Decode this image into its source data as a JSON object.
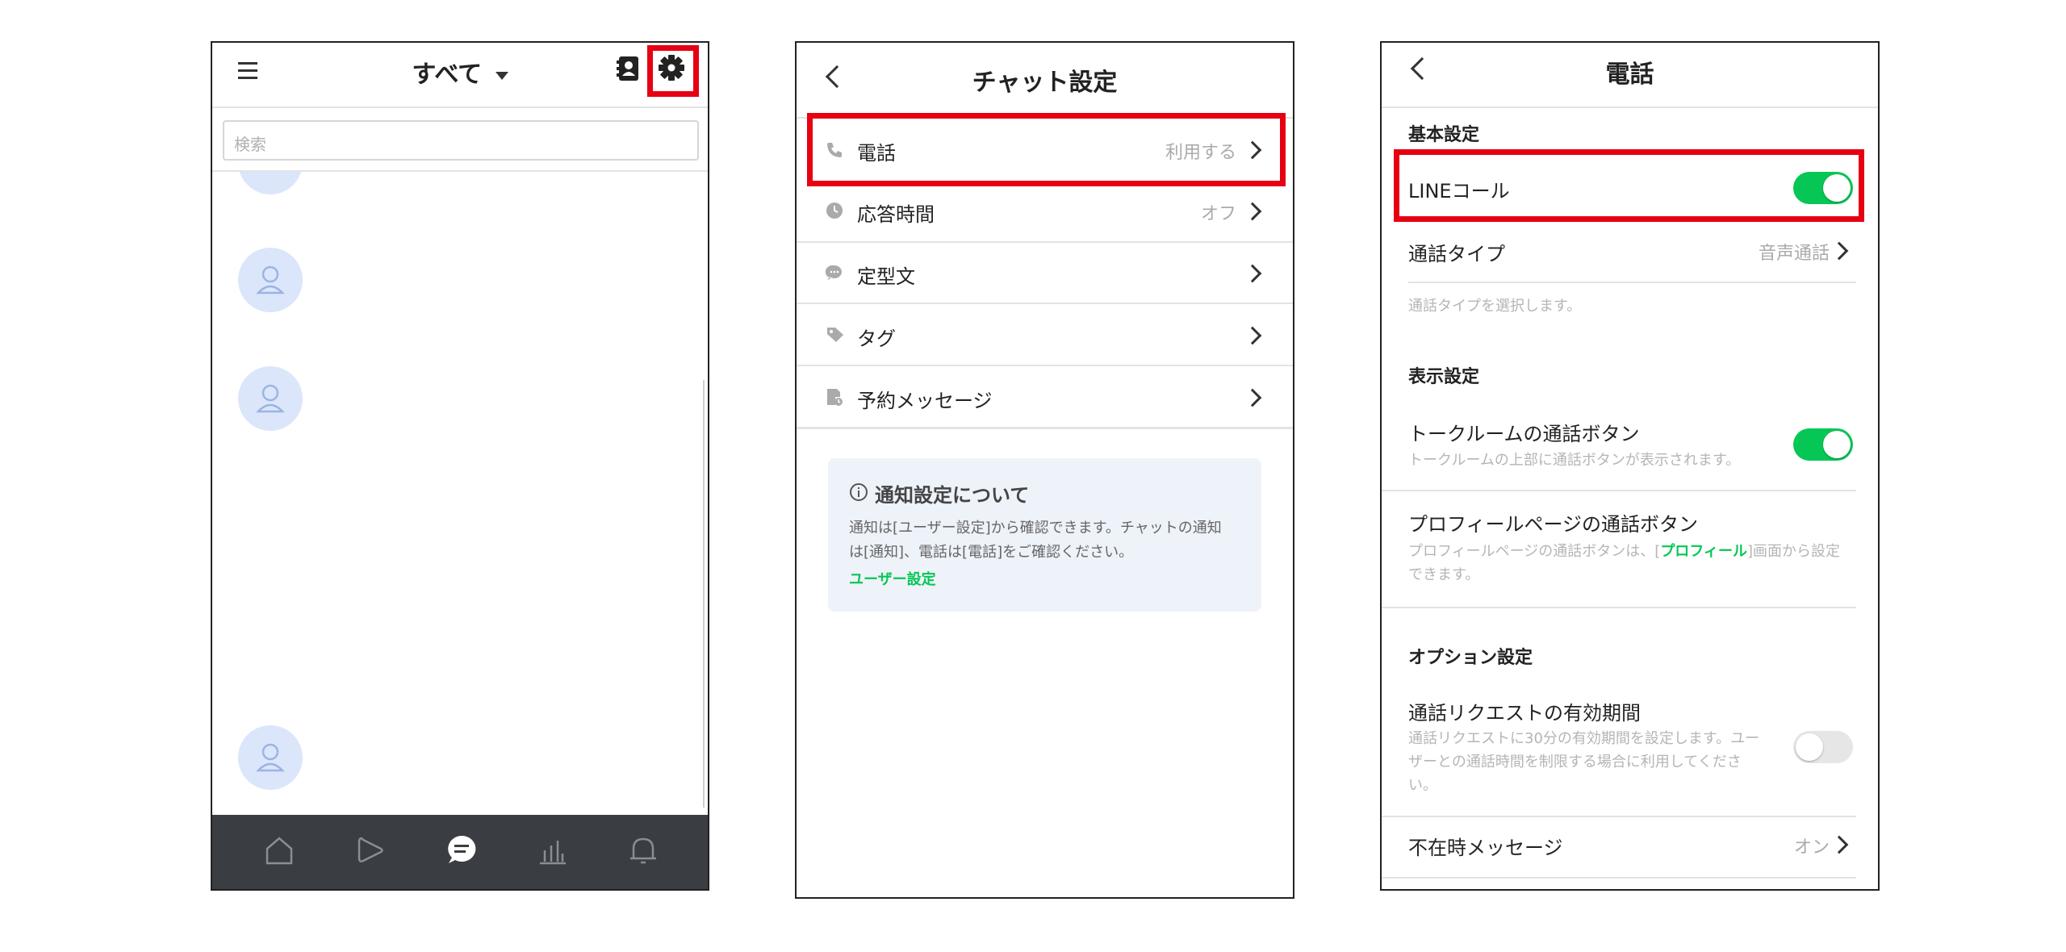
{
  "screen1": {
    "header_title": "すべて",
    "search_placeholder": "検索",
    "bottom_nav": [
      "home-icon",
      "play-icon",
      "chat-icon",
      "stats-icon",
      "bell-icon"
    ]
  },
  "screen2": {
    "title": "チャット設定",
    "items": [
      {
        "label": "電話",
        "value": "利用する",
        "icon": "phone-icon"
      },
      {
        "label": "応答時間",
        "value": "オフ",
        "icon": "clock-icon"
      },
      {
        "label": "定型文",
        "value": "",
        "icon": "speech-bubble-icon"
      },
      {
        "label": "タグ",
        "value": "",
        "icon": "tag-icon"
      },
      {
        "label": "予約メッセージ",
        "value": "",
        "icon": "scheduled-message-icon"
      }
    ],
    "info": {
      "title": "通知設定について",
      "line1": "通知は[ユーザー設定]から確認できます。チャットの通知",
      "line2": "は[通知]、電話は[電話]をご確認ください。",
      "link": "ユーザー設定"
    }
  },
  "screen3": {
    "title": "電話",
    "section_basic": "基本設定",
    "line_call_label": "LINEコール",
    "line_call_on": true,
    "call_type_label": "通話タイプ",
    "call_type_value": "音声通話",
    "call_type_desc": "通話タイプを選択します。",
    "section_display": "表示設定",
    "talkroom_button_label": "トークルームの通話ボタン",
    "talkroom_button_desc": "トークルームの上部に通話ボタンが表示されます。",
    "talkroom_button_on": true,
    "profile_button_label": "プロフィールページの通話ボタン",
    "profile_desc_prefix": "プロフィールページの通話ボタンは、[",
    "profile_desc_link": "プロフィール",
    "profile_desc_suffix": "]画面から設定",
    "profile_desc_line2": "できます。",
    "section_option": "オプション設定",
    "request_label": "通話リクエストの有効期間",
    "request_desc_line1": "通話リクエストに30分の有効期間を設定します。ユー",
    "request_desc_line2": "ザーとの通話時間を制限する場合に利用してくださ",
    "request_desc_line3": "い。",
    "request_on": false,
    "absence_label": "不在時メッセージ",
    "absence_value": "オン"
  },
  "colors": {
    "highlight": "#e60012",
    "accent_green": "#06c755",
    "nav_bg": "#3a3d42",
    "avatar_bg": "#dbe6fb",
    "info_bg": "#eef2f9"
  }
}
